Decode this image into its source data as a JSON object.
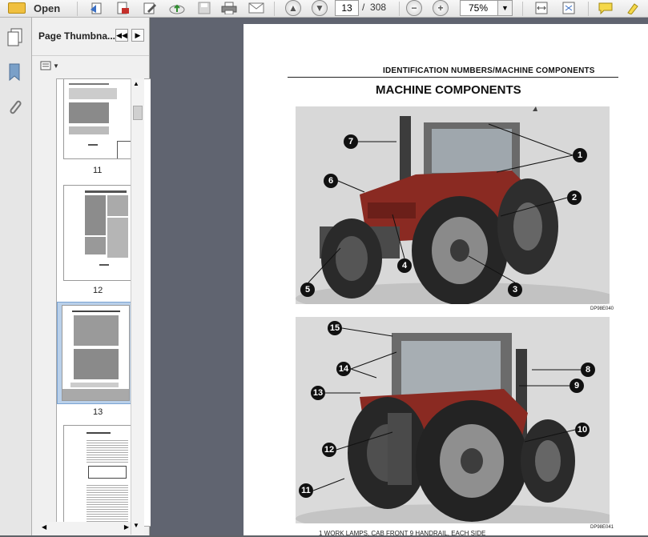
{
  "toolbar": {
    "open_label": "Open",
    "current_page": "13",
    "page_separator": "/",
    "total_pages": "308",
    "zoom": "75%"
  },
  "panel": {
    "title": "Page Thumbna...",
    "prev_icon": "◀◀",
    "next_icon": "▶",
    "thumbnails": [
      {
        "label": "11"
      },
      {
        "label": "12"
      },
      {
        "label": "13"
      }
    ]
  },
  "page": {
    "section_header": "IDENTIFICATION NUMBERS/MACHINE COMPONENTS",
    "title": "MACHINE COMPONENTS",
    "photo1_caption": "DP98E040",
    "photo2_caption": "DP98E041",
    "footnote": "1    WORK LAMPS, CAB FRONT                         9    HANDRAIL, EACH SIDE",
    "callouts_top": [
      "7",
      "1",
      "6",
      "2",
      "4",
      "5",
      "3"
    ],
    "callouts_bottom": [
      "15",
      "14",
      "8",
      "9",
      "13",
      "10",
      "12",
      "11"
    ]
  },
  "colors": {
    "toolbar_bg": "#ececec",
    "document_bg": "#606470",
    "tractor_red": "#8a2a22"
  }
}
